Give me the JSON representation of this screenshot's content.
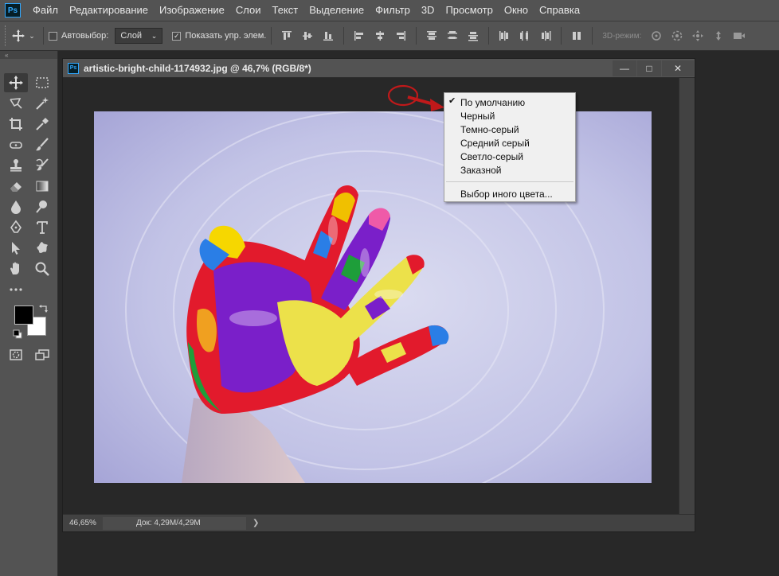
{
  "menubar": {
    "items": [
      "Файл",
      "Редактирование",
      "Изображение",
      "Слои",
      "Текст",
      "Выделение",
      "Фильтр",
      "3D",
      "Просмотр",
      "Окно",
      "Справка"
    ]
  },
  "options": {
    "autoselect_label": "Автовыбор:",
    "autoselect_value": "Слой",
    "show_controls_label": "Показать упр. элем.",
    "mode_3d_label": "3D-режим:"
  },
  "document": {
    "title": "artistic-bright-child-1174932.jpg @ 46,7% (RGB/8*)",
    "zoom": "46,65%",
    "doc_info": "Док: 4,29M/4,29M"
  },
  "context_menu": {
    "items": [
      {
        "label": "По умолчанию",
        "checked": true
      },
      {
        "label": "Черный",
        "checked": false
      },
      {
        "label": "Темно-серый",
        "checked": false
      },
      {
        "label": "Средний серый",
        "checked": false
      },
      {
        "label": "Светло-серый",
        "checked": false
      },
      {
        "label": "Заказной",
        "checked": false
      }
    ],
    "custom_label": "Выбор иного цвета..."
  },
  "colors": {
    "foreground": "#000000",
    "background": "#ffffff",
    "annotation": "#c0191a"
  }
}
